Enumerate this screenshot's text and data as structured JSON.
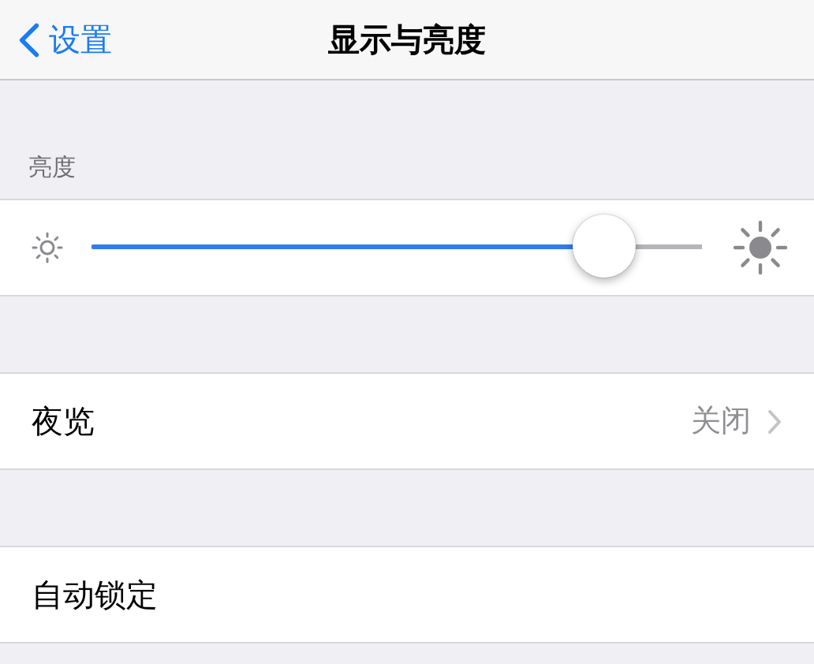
{
  "nav": {
    "back": "设置",
    "title": "显示与亮度"
  },
  "brightness": {
    "header": "亮度",
    "level": 0.84
  },
  "rows": [
    {
      "label": "夜览",
      "value": "关闭",
      "kind": "disclosure"
    },
    {
      "label": "自动锁定",
      "kind": "plain"
    }
  ]
}
